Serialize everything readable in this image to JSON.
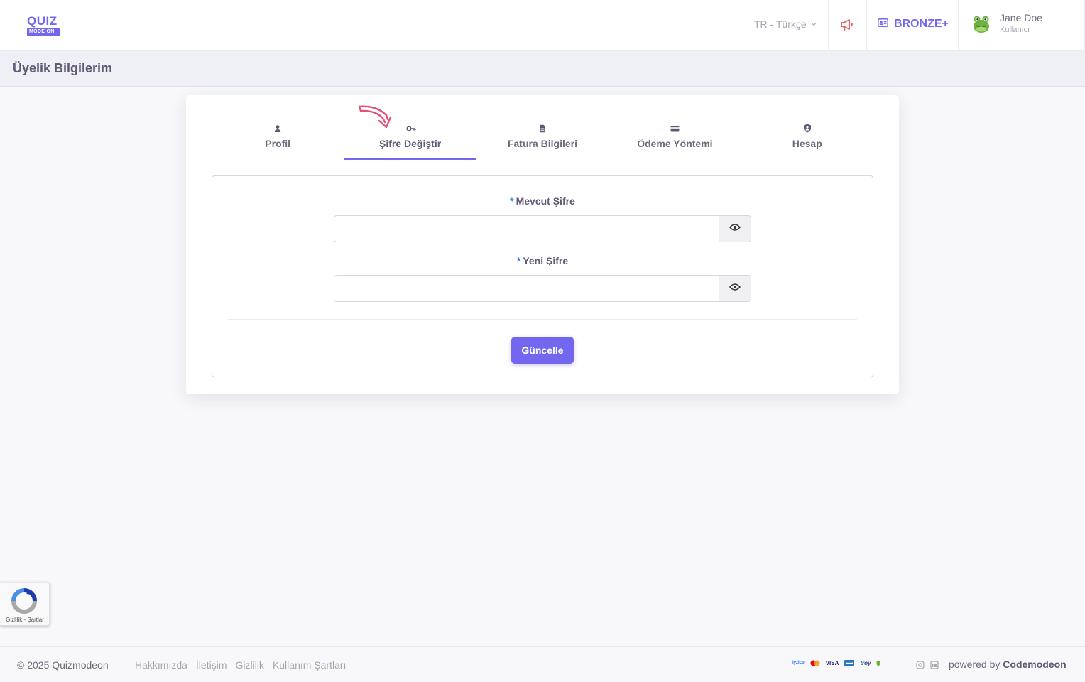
{
  "header": {
    "logo_top": "QUIZ",
    "logo_bottom": "MODE ON",
    "language": "TR - Türkçe",
    "plan": "BRONZE+",
    "user_name": "Jane Doe",
    "user_role": "Kullanıcı"
  },
  "page_title": "Üyelik Bilgilerim",
  "tabs": [
    {
      "label": "Profil",
      "icon": "user-icon"
    },
    {
      "label": "Şifre Değiştir",
      "icon": "key-icon",
      "active": true
    },
    {
      "label": "Fatura Bilgileri",
      "icon": "document-icon"
    },
    {
      "label": "Ödeme Yöntemi",
      "icon": "credit-card-icon"
    },
    {
      "label": "Hesap",
      "icon": "shield-user-icon"
    }
  ],
  "form": {
    "current_password_label": "Mevcut Şifre",
    "new_password_label": "Yeni Şifre",
    "required_mark": "*",
    "current_password_value": "",
    "new_password_value": "",
    "submit_label": "Güncelle"
  },
  "recaptcha": {
    "text": "Gizlilik - Şartlar"
  },
  "footer": {
    "copyright": "© 2025 Quizmodeon",
    "links": [
      "Hakkımızda",
      "İletişim",
      "Gizlilik",
      "Kullanım Şartları"
    ],
    "payments": [
      "iyzico",
      "mastercard",
      "VISA",
      "amex",
      "troy"
    ],
    "powered_prefix": "powered by",
    "powered_brand": "Codemodeon"
  },
  "colors": {
    "primary": "#7367f0",
    "text": "#5e5873",
    "muted": "#a6a4b0",
    "accent_red": "#ea5455",
    "required": "#2e7de9"
  }
}
